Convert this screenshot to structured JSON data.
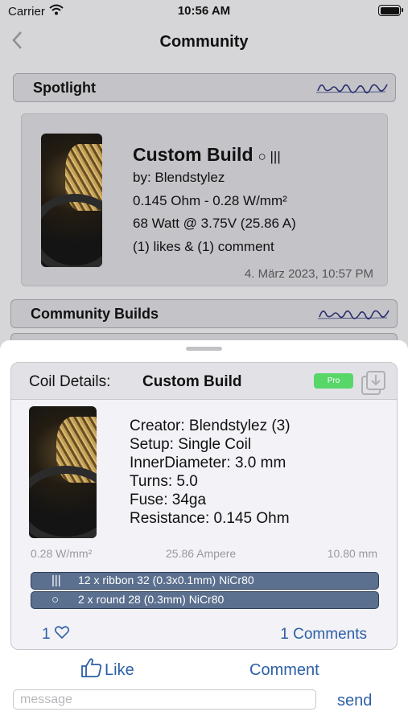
{
  "status_bar": {
    "carrier": "Carrier",
    "time": "10:56 AM"
  },
  "nav": {
    "title": "Community"
  },
  "spotlight": {
    "header": "Spotlight",
    "card": {
      "title": "Custom Build",
      "coil_symbols": "○ |||",
      "by": "by:  Blendstylez",
      "specs1": "0.145 Ohm - 0.28 W/mm²",
      "specs2": "68 Watt @ 3.75V (25.86 A)",
      "engagement": "(1) likes &  (1) comment",
      "date": "4. März 2023, 10:57 PM"
    }
  },
  "community_builds": {
    "header": "Community Builds"
  },
  "coil_details": {
    "label": "Coil Details:",
    "title": "Custom Build",
    "pro_badge": "Pro",
    "creator": "Creator: Blendstylez (3)",
    "setup": "Setup: Single Coil",
    "inner_diameter": "InnerDiameter: 3.0 mm",
    "turns": "Turns: 5.0",
    "fuse": "Fuse: 34ga",
    "resistance": "Resistance: 0.145 Ohm",
    "stats": [
      "0.28 W/mm²",
      "25.86 Ampere",
      "10.80 mm"
    ],
    "wires": [
      {
        "symbol": "|||",
        "text": "12 x ribbon 32 (0.3x0.1mm) NiCr80"
      },
      {
        "symbol": "○",
        "text": "2 x round 28 (0.3mm) NiCr80"
      }
    ],
    "likes_count": "1",
    "comments_link": "1 Comments"
  },
  "actions": {
    "like_label": "Like",
    "comment_label": "Comment",
    "message_placeholder": "message",
    "send_label": "send"
  },
  "colors": {
    "link": "#2d5fa6",
    "pro": "#58d668",
    "wire_bg": "#5b6f8f"
  }
}
